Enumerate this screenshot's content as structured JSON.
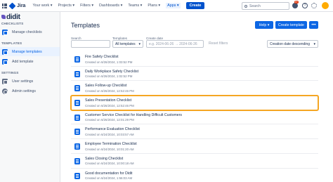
{
  "topnav": {
    "brand": "Jira",
    "items": [
      "Your work ▾",
      "Projects ▾",
      "Filters ▾",
      "Dashboards ▾",
      "Teams ▾",
      "Plans ▾",
      "Apps ▾"
    ],
    "create_label": "Create",
    "search_placeholder": "Search",
    "notification_count": "9+"
  },
  "sidebar": {
    "brand": "didit",
    "sections": [
      {
        "title": "CHECKLISTS",
        "items": [
          {
            "label": "Manage checklists"
          }
        ]
      },
      {
        "title": "TEMPLATES",
        "items": [
          {
            "label": "Manage templates"
          },
          {
            "label": "Add template"
          }
        ]
      },
      {
        "title": "SETTINGS",
        "items": [
          {
            "label": "User settings"
          },
          {
            "label": "Admin settings"
          }
        ]
      }
    ]
  },
  "main": {
    "title": "Templates",
    "help_label": "Help ▾",
    "create_template_label": "Create template",
    "more_label": "•••",
    "filters": {
      "search_label": "Search",
      "templates_label": "Templates",
      "templates_value": "All templates",
      "date_label": "Create date",
      "date_placeholder": "e.g. 2024-06-26 → 2024-06-26",
      "reset_label": "Reset filters",
      "sort_value": "Creation date descending"
    },
    "templates": [
      {
        "title": "Fire Safety Checklist",
        "date": "Created on 6/26/2024, 1:03:52 PM"
      },
      {
        "title": "Daily Workplace Safety Checklist",
        "date": "Created on 6/26/2024, 1:02:52 PM"
      },
      {
        "title": "Sales Follow-up Checklist",
        "date": "Created on 6/26/2024, 12:52:46 PM"
      },
      {
        "title": "Sales Presentation Checklist",
        "date": "Created on 6/26/2024, 12:52:46 PM"
      },
      {
        "title": "Customer Service Checklist for Handling Difficult Customers",
        "date": "Created on 6/26/2024, 12:01:29 PM"
      },
      {
        "title": "Performance Evaluation Checklist",
        "date": "Created on 6/24/2024, 10:03:57 AM"
      },
      {
        "title": "Employee Termination Checklist",
        "date": "Created on 6/24/2024, 10:01:20 AM"
      },
      {
        "title": "Sales Closing Checklist",
        "date": "Created on 6/24/2024, 10:00:18 AM"
      },
      {
        "title": "Good documentation for Didit",
        "date": "Created on 6/24/2024, 1:56:03 AM"
      }
    ],
    "highlighted_index": 3
  },
  "colors": {
    "accent": "#0c66e4",
    "highlight": "#f5a623"
  }
}
